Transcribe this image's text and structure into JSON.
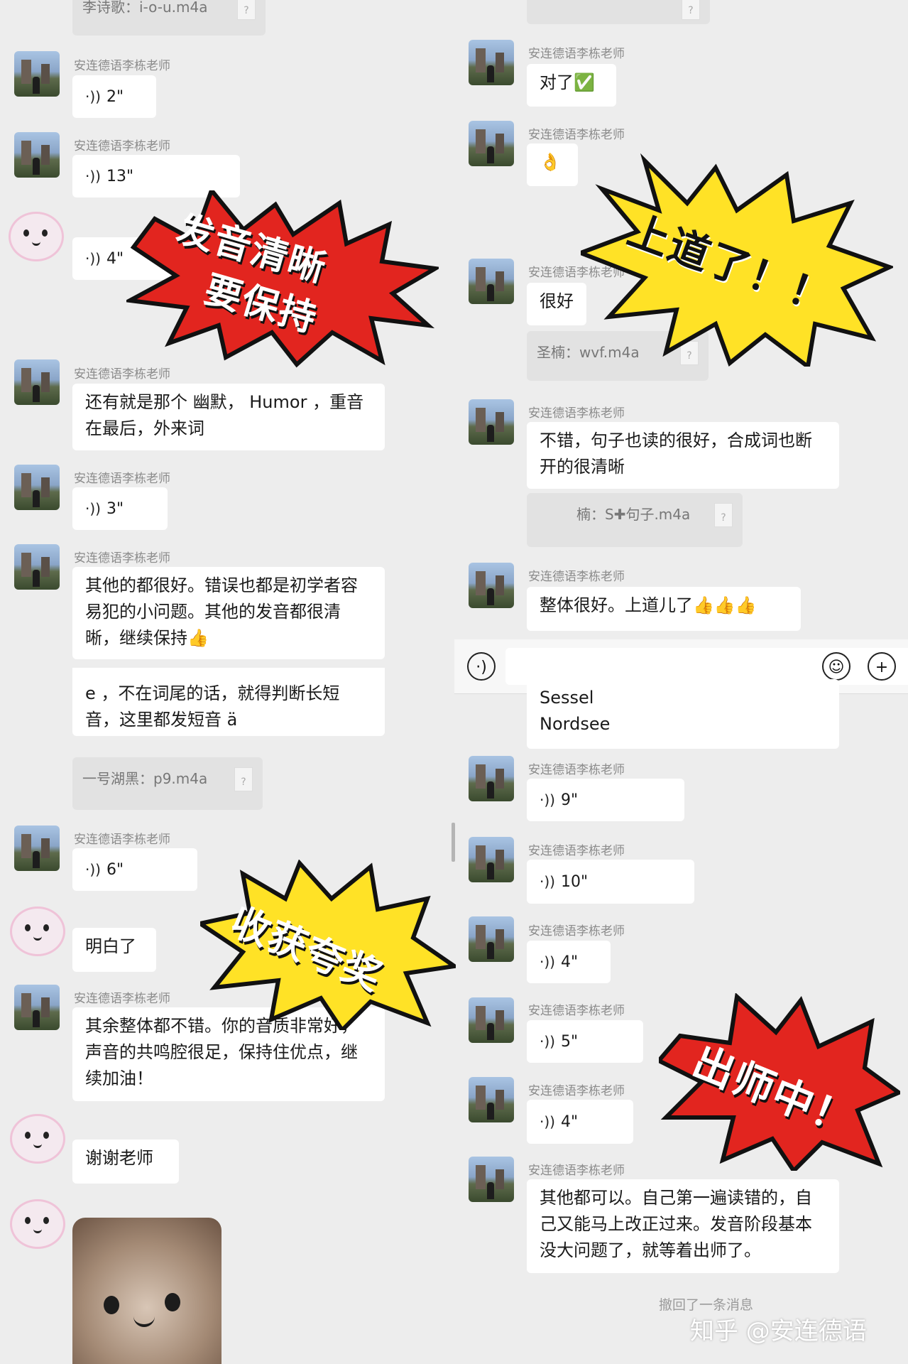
{
  "teacher_name": "安连德语李栋老师",
  "left_top": {
    "file_prev": "李诗歌：i-o-u.m4a",
    "voice1": "2\"",
    "voice2": "13\"",
    "voice3": "4\"",
    "msg_humor": "还有就是那个 幽默， Humor ，重音在最后，外来词",
    "voice4": "3\"",
    "msg_good": "其他的都很好。错误也都是初学者容易犯的小问题。其他的发音都很清晰，继续保持👍"
  },
  "right_top": {
    "msg_duile": "对了✅",
    "msg_ok": "👌",
    "msg_henhao": "很好",
    "file_wvf": "圣楠：wvf.m4a",
    "msg_bucuo": "不错，句子也读的很好，合成词也断开的很清晰",
    "file_s": "楠：S✚句子.m4a",
    "msg_zhengti": "整体很好。上道儿了👍👍👍"
  },
  "left_bottom": {
    "msg_duan": "e ，不在词尾的话，就得判断长短音，这里都发短音 ä",
    "file_p9": "一号湖黑：p9.m4a",
    "voice5": "6\"",
    "msg_mingbai": "明白了",
    "msg_yuzhi": "其余整体都不错。你的音质非常好，声音的共鸣腔很足，保持住优点，继续加油！",
    "msg_xiexie": "谢谢老师"
  },
  "right_bottom": {
    "msg_words": "Sessel\nNordsee",
    "voice6": "9\"",
    "voice7": "10\"",
    "voice8": "4\"",
    "voice9": "5\"",
    "voice10": "4\"",
    "msg_final": "其他都可以。自己第一遍读错的，自己又能马上改正过来。发音阶段基本没大问题了，就等着出师了。",
    "recall": "撤回了一条消息",
    "input_voice_icon": "voice-icon",
    "input_emoji_icon": "emoji-icon",
    "input_plus_icon": "plus-icon"
  },
  "stickers": {
    "burst1_line1": "发音清晰",
    "burst1_line2": "要保持",
    "burst2": "上道了！！",
    "burst3": "收获夸奖",
    "burst4": "出师中！"
  },
  "watermark": "知乎 @安连德语",
  "colors": {
    "burst_red": "#e2251f",
    "burst_yellow": "#ffe226",
    "bubble": "#ffffff",
    "bg": "#ededed"
  }
}
